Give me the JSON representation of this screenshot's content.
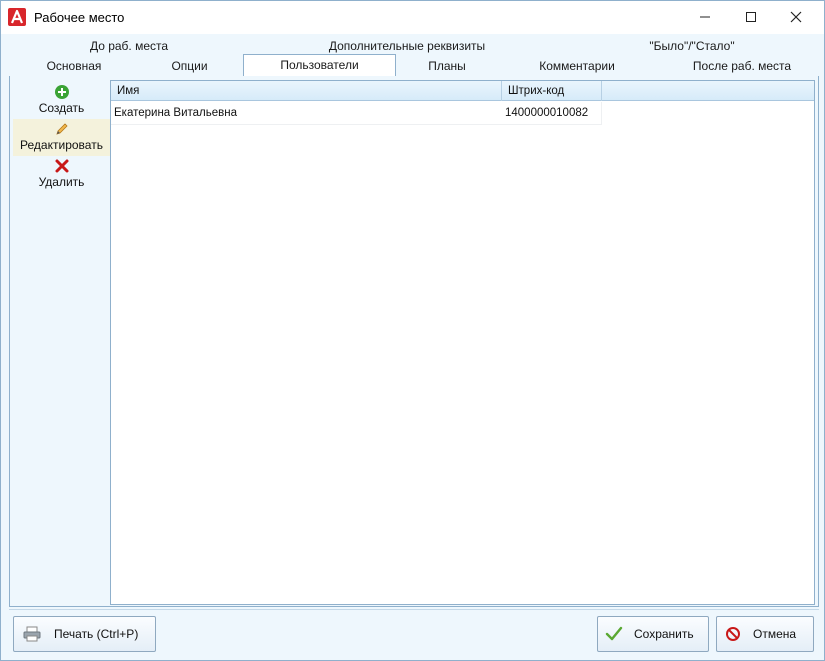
{
  "window": {
    "title": "Рабочее место",
    "controls": {
      "minimize": "—",
      "maximize": "☐",
      "close": "✕"
    }
  },
  "tabs": {
    "row1": [
      "До раб. места",
      "Дополнительные реквизиты",
      "\"Было\"/\"Стало\""
    ],
    "row2": [
      "Основная",
      "Опции",
      "Пользователи",
      "Планы",
      "Комментарии",
      "После раб. места"
    ],
    "active": "Пользователи"
  },
  "sidebar": {
    "create": "Создать",
    "edit": "Редактировать",
    "delete": "Удалить"
  },
  "grid": {
    "columns": [
      "Имя",
      "Штрих-код"
    ],
    "rows": [
      [
        "Екатерина Витальевна",
        "1400000010082"
      ]
    ]
  },
  "footer": {
    "print": "Печать (Ctrl+P)",
    "save": "Сохранить",
    "cancel": "Отмена"
  },
  "colors": {
    "accent": "#8fb0cc",
    "create_icon": "#3aa335",
    "delete_icon": "#c81818",
    "save_icon": "#5aa832",
    "cancel_icon": "#c81818",
    "app_icon": "#d8262b"
  },
  "icons": {
    "app": "app-logo-icon",
    "create": "plus-circle-icon",
    "edit": "pencil-icon",
    "delete": "x-icon",
    "print": "printer-icon",
    "save": "check-icon",
    "cancel": "no-entry-icon"
  }
}
